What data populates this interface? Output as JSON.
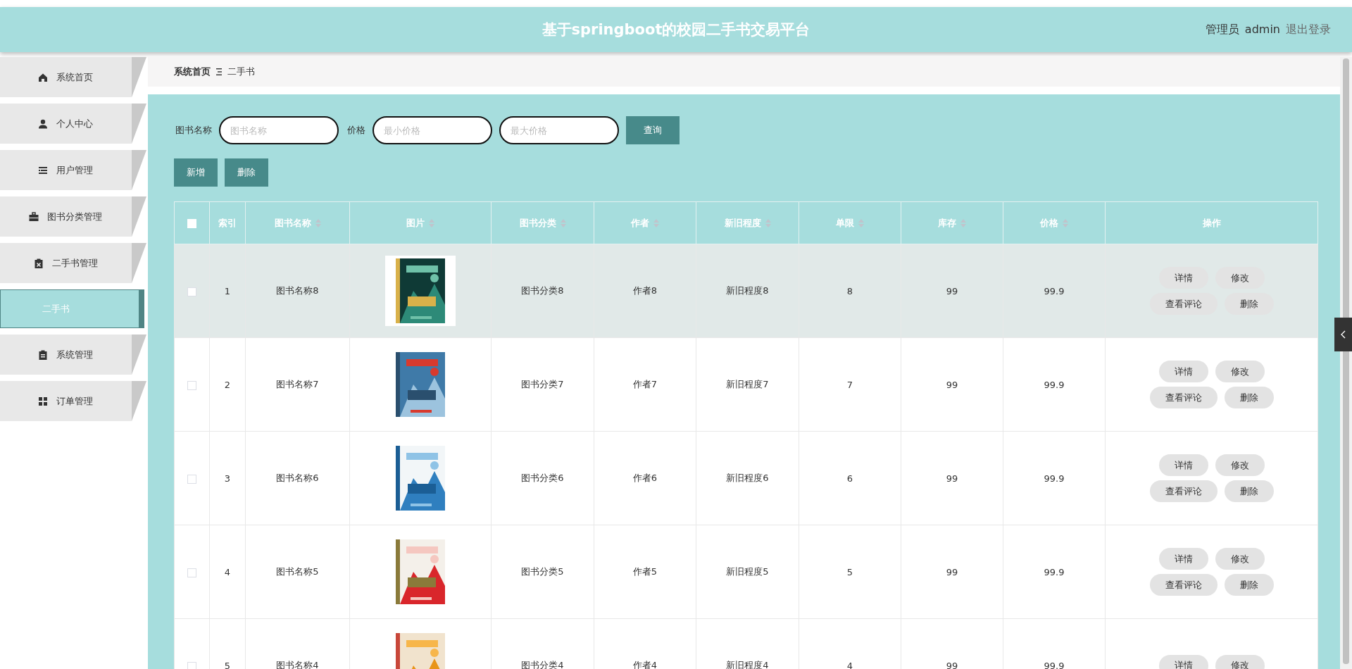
{
  "header": {
    "title": "基于springboot的校园二手书交易平台",
    "user_role": "管理员",
    "user_name": "admin",
    "logout": "退出登录"
  },
  "sidebar": {
    "items": [
      {
        "label": "系统首页",
        "selected": false
      },
      {
        "label": "个人中心",
        "selected": false
      },
      {
        "label": "用户管理",
        "selected": false
      },
      {
        "label": "图书分类管理",
        "selected": false
      },
      {
        "label": "二手书管理",
        "selected": false,
        "children": [
          {
            "label": "二手书",
            "selected": true
          }
        ]
      },
      {
        "label": "系统管理",
        "selected": false
      },
      {
        "label": "订单管理",
        "selected": false
      }
    ]
  },
  "breadcrumb": [
    "系统首页",
    "二手书"
  ],
  "search": {
    "fields": [
      {
        "label": "图书名称",
        "placeholder": "图书名称"
      },
      {
        "label": "价格",
        "placeholder": "最小价格"
      },
      {
        "placeholder": "最大价格"
      }
    ],
    "button": "查询"
  },
  "actions": [
    "新增",
    "删除"
  ],
  "table": {
    "select_all": {
      "checked": false
    },
    "columns": [
      {
        "label": "索引",
        "sortable": false
      },
      {
        "label": "图书名称",
        "sortable": true
      },
      {
        "label": "图片",
        "sortable": true
      },
      {
        "label": "图书分类",
        "sortable": true
      },
      {
        "label": "作者",
        "sortable": true
      },
      {
        "label": "新旧程度",
        "sortable": true
      },
      {
        "label": "单限",
        "sortable": true
      },
      {
        "label": "库存",
        "sortable": true
      },
      {
        "label": "价格",
        "sortable": true
      },
      {
        "label": "操作",
        "sortable": false
      }
    ],
    "rows": [
      {
        "checked": false,
        "hovered": true,
        "cells": [
          "1",
          "图书名称8",
          "",
          "图书分类8",
          "作者8",
          "新旧程度8",
          "8",
          "99",
          "99.9"
        ],
        "buttons": [
          "详情",
          "修改",
          "查看评论",
          "删除"
        ]
      },
      {
        "checked": false,
        "hovered": false,
        "cells": [
          "2",
          "图书名称7",
          "",
          "图书分类7",
          "作者7",
          "新旧程度7",
          "7",
          "99",
          "99.9"
        ],
        "buttons": [
          "详情",
          "修改",
          "查看评论",
          "删除"
        ]
      },
      {
        "checked": false,
        "hovered": false,
        "cells": [
          "3",
          "图书名称6",
          "",
          "图书分类6",
          "作者6",
          "新旧程度6",
          "6",
          "99",
          "99.9"
        ],
        "buttons": [
          "详情",
          "修改",
          "查看评论",
          "删除"
        ]
      },
      {
        "checked": false,
        "hovered": false,
        "cells": [
          "4",
          "图书名称5",
          "",
          "图书分类5",
          "作者5",
          "新旧程度5",
          "5",
          "99",
          "99.9"
        ],
        "buttons": [
          "详情",
          "修改",
          "查看评论",
          "删除"
        ]
      },
      {
        "checked": false,
        "hovered": false,
        "cells": [
          "5",
          "图书名称4",
          "",
          "图书分类4",
          "作者4",
          "新旧程度4",
          "4",
          "99",
          "99.9"
        ],
        "buttons": [
          "详情",
          "修改"
        ]
      }
    ]
  }
}
